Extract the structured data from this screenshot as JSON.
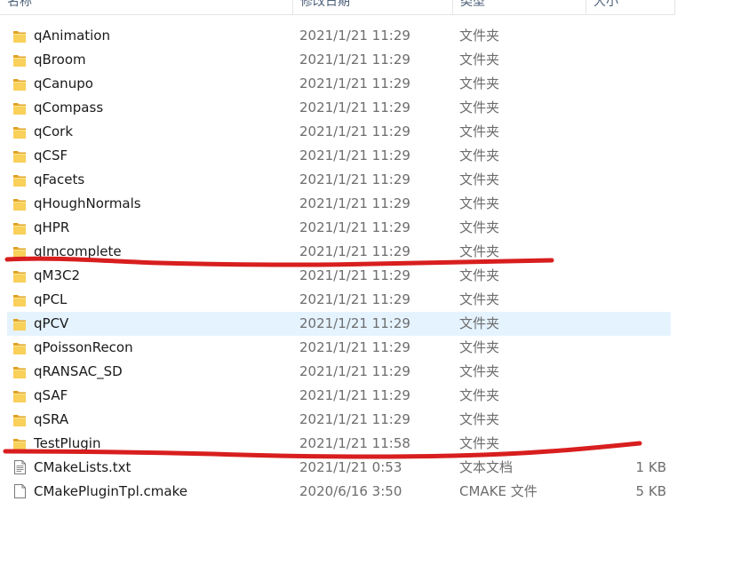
{
  "header": {
    "name": "名称",
    "date": "修改日期",
    "type": "类型",
    "size": "大小"
  },
  "items": [
    {
      "name": "qAnimation",
      "date": "2021/1/21 11:29",
      "type": "文件夹",
      "size": "",
      "icon": "folder-icon"
    },
    {
      "name": "qBroom",
      "date": "2021/1/21 11:29",
      "type": "文件夹",
      "size": "",
      "icon": "folder-icon"
    },
    {
      "name": "qCanupo",
      "date": "2021/1/21 11:29",
      "type": "文件夹",
      "size": "",
      "icon": "folder-icon"
    },
    {
      "name": "qCompass",
      "date": "2021/1/21 11:29",
      "type": "文件夹",
      "size": "",
      "icon": "folder-icon"
    },
    {
      "name": "qCork",
      "date": "2021/1/21 11:29",
      "type": "文件夹",
      "size": "",
      "icon": "folder-icon"
    },
    {
      "name": "qCSF",
      "date": "2021/1/21 11:29",
      "type": "文件夹",
      "size": "",
      "icon": "folder-icon"
    },
    {
      "name": "qFacets",
      "date": "2021/1/21 11:29",
      "type": "文件夹",
      "size": "",
      "icon": "folder-icon"
    },
    {
      "name": "qHoughNormals",
      "date": "2021/1/21 11:29",
      "type": "文件夹",
      "size": "",
      "icon": "folder-icon"
    },
    {
      "name": "qHPR",
      "date": "2021/1/21 11:29",
      "type": "文件夹",
      "size": "",
      "icon": "folder-icon"
    },
    {
      "name": "qImcomplete",
      "date": "2021/1/21 11:29",
      "type": "文件夹",
      "size": "",
      "icon": "folder-icon"
    },
    {
      "name": "qM3C2",
      "date": "2021/1/21 11:29",
      "type": "文件夹",
      "size": "",
      "icon": "folder-icon"
    },
    {
      "name": "qPCL",
      "date": "2021/1/21 11:29",
      "type": "文件夹",
      "size": "",
      "icon": "folder-icon"
    },
    {
      "name": "qPCV",
      "date": "2021/1/21 11:29",
      "type": "文件夹",
      "size": "",
      "icon": "folder-icon",
      "selected": true
    },
    {
      "name": "qPoissonRecon",
      "date": "2021/1/21 11:29",
      "type": "文件夹",
      "size": "",
      "icon": "folder-icon"
    },
    {
      "name": "qRANSAC_SD",
      "date": "2021/1/21 11:29",
      "type": "文件夹",
      "size": "",
      "icon": "folder-icon"
    },
    {
      "name": "qSAF",
      "date": "2021/1/21 11:29",
      "type": "文件夹",
      "size": "",
      "icon": "folder-icon"
    },
    {
      "name": "qSRA",
      "date": "2021/1/21 11:29",
      "type": "文件夹",
      "size": "",
      "icon": "folder-icon"
    },
    {
      "name": "TestPlugin",
      "date": "2021/1/21 11:58",
      "type": "文件夹",
      "size": "",
      "icon": "folder-icon"
    },
    {
      "name": "CMakeLists.txt",
      "date": "2021/1/21 0:53",
      "type": "文本文档",
      "size": "1 KB",
      "icon": "text-file-icon"
    },
    {
      "name": "CMakePluginTpl.cmake",
      "date": "2020/6/16 3:50",
      "type": "CMAKE 文件",
      "size": "5 KB",
      "icon": "file-icon"
    }
  ],
  "colors": {
    "folder": "#f5c542",
    "selection": "#e5f3ff",
    "annotation": "#d81e1e"
  }
}
